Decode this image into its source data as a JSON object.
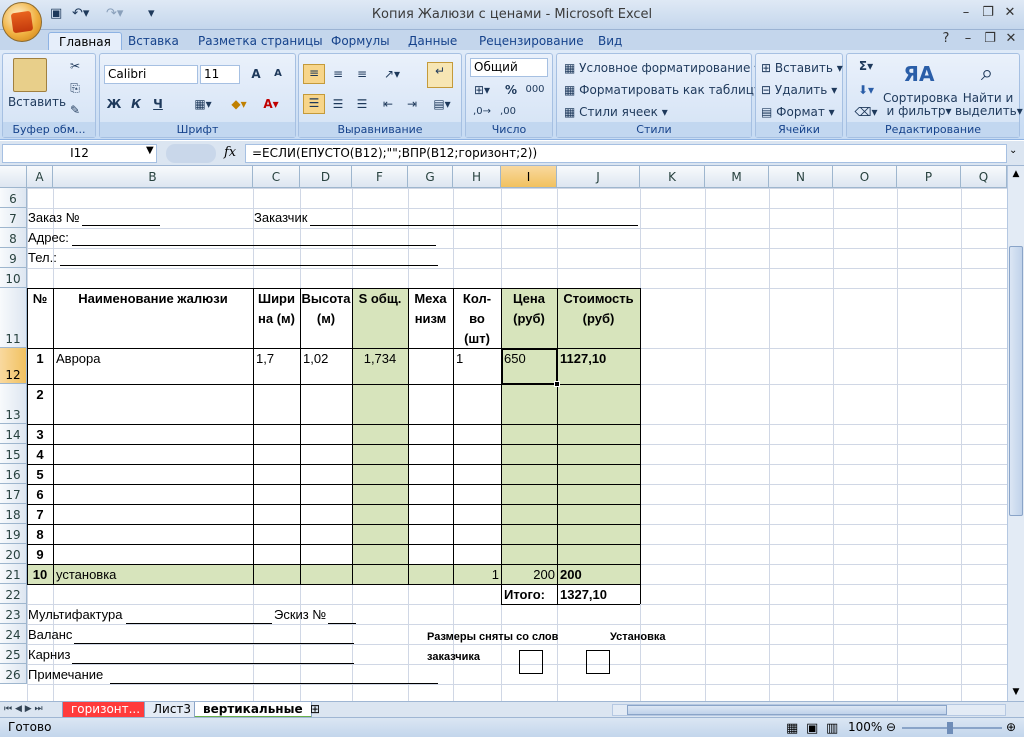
{
  "window": {
    "title": "Копия Жалюзи с ценами - Microsoft Excel"
  },
  "ribbon_tabs": [
    "Главная",
    "Вставка",
    "Разметка страницы",
    "Формулы",
    "Данные",
    "Рецензирование",
    "Вид"
  ],
  "ribbon": {
    "clipboard": {
      "label": "Буфер обм...",
      "paste": "Вставить"
    },
    "font": {
      "label": "Шрифт",
      "name": "Calibri",
      "size": "11",
      "bold": "Ж",
      "italic": "К",
      "underline": "Ч"
    },
    "alignment": {
      "label": "Выравнивание"
    },
    "number": {
      "label": "Число",
      "format": "Общий"
    },
    "styles": {
      "label": "Стили",
      "cond": "Условное форматирование",
      "table": "Форматировать как таблицу",
      "cell": "Стили ячеек"
    },
    "cells": {
      "label": "Ячейки",
      "insert": "Вставить",
      "delete": "Удалить",
      "format": "Формат"
    },
    "editing": {
      "label": "Редактирование",
      "sort1": "Сортировка",
      "sort2": "и фильтр",
      "find1": "Найти и",
      "find2": "выделить"
    }
  },
  "formula_bar": {
    "name_box": "I12",
    "fx": "fx",
    "formula": "=ЕСЛИ(ЕПУСТО(B12);\"\";ВПР(B12;горизонт;2))"
  },
  "columns": [
    "A",
    "B",
    "C",
    "D",
    "F",
    "G",
    "H",
    "I",
    "J",
    "K",
    "M",
    "N",
    "O",
    "P",
    "Q"
  ],
  "rows": [
    "6",
    "7",
    "8",
    "9",
    "10",
    "11",
    "12",
    "13",
    "14",
    "15",
    "16",
    "17",
    "18",
    "19",
    "20",
    "21",
    "22",
    "23",
    "24",
    "25",
    "26"
  ],
  "cells": {
    "order": "Заказ №",
    "customer": "Заказчик",
    "address": "Адрес:",
    "phone": "Тел.:",
    "h_no": "№",
    "h_name": "Наименование жалюзи",
    "h_width": "Шири на (м)",
    "h_height": "Высота (м)",
    "h_area": "S общ.",
    "h_mech": "Меха низм",
    "h_qty": "Кол-во (шт)",
    "h_price": "Цена (руб)",
    "h_cost": "Стоимость (руб)",
    "r1_no": "1",
    "r1_name": "Аврора",
    "r1_w": "1,7",
    "r1_h": "1,02",
    "r1_s": "1,734",
    "r1_q": "1",
    "r1_price": "650",
    "r1_cost": "1127,10",
    "n2": "2",
    "n3": "3",
    "n4": "4",
    "n5": "5",
    "n6": "6",
    "n7": "7",
    "n8": "8",
    "n9": "9",
    "n10": "10",
    "install": "установка",
    "inst_qty": "1",
    "inst_price": "200",
    "inst_cost": "200",
    "total_label": "Итого:",
    "total": "1327,10",
    "multi": "Мультифактура",
    "sketch": "Эскиз №",
    "balance": "Валанс",
    "cornice": "Карниз",
    "note": "Примечание",
    "sizes1": "Размеры сняты со слов",
    "sizes2": "заказчика",
    "install_lbl": "Установка"
  },
  "sheets": [
    "горизонт...",
    "Лист3",
    "вертикальные"
  ],
  "status": {
    "ready": "Готово",
    "zoom": "100%"
  },
  "colors": {
    "green_fill": "#d7e4bc",
    "sheet_tab_red": "#ff3b3b",
    "sheet_tab_active": "#ffffff"
  }
}
